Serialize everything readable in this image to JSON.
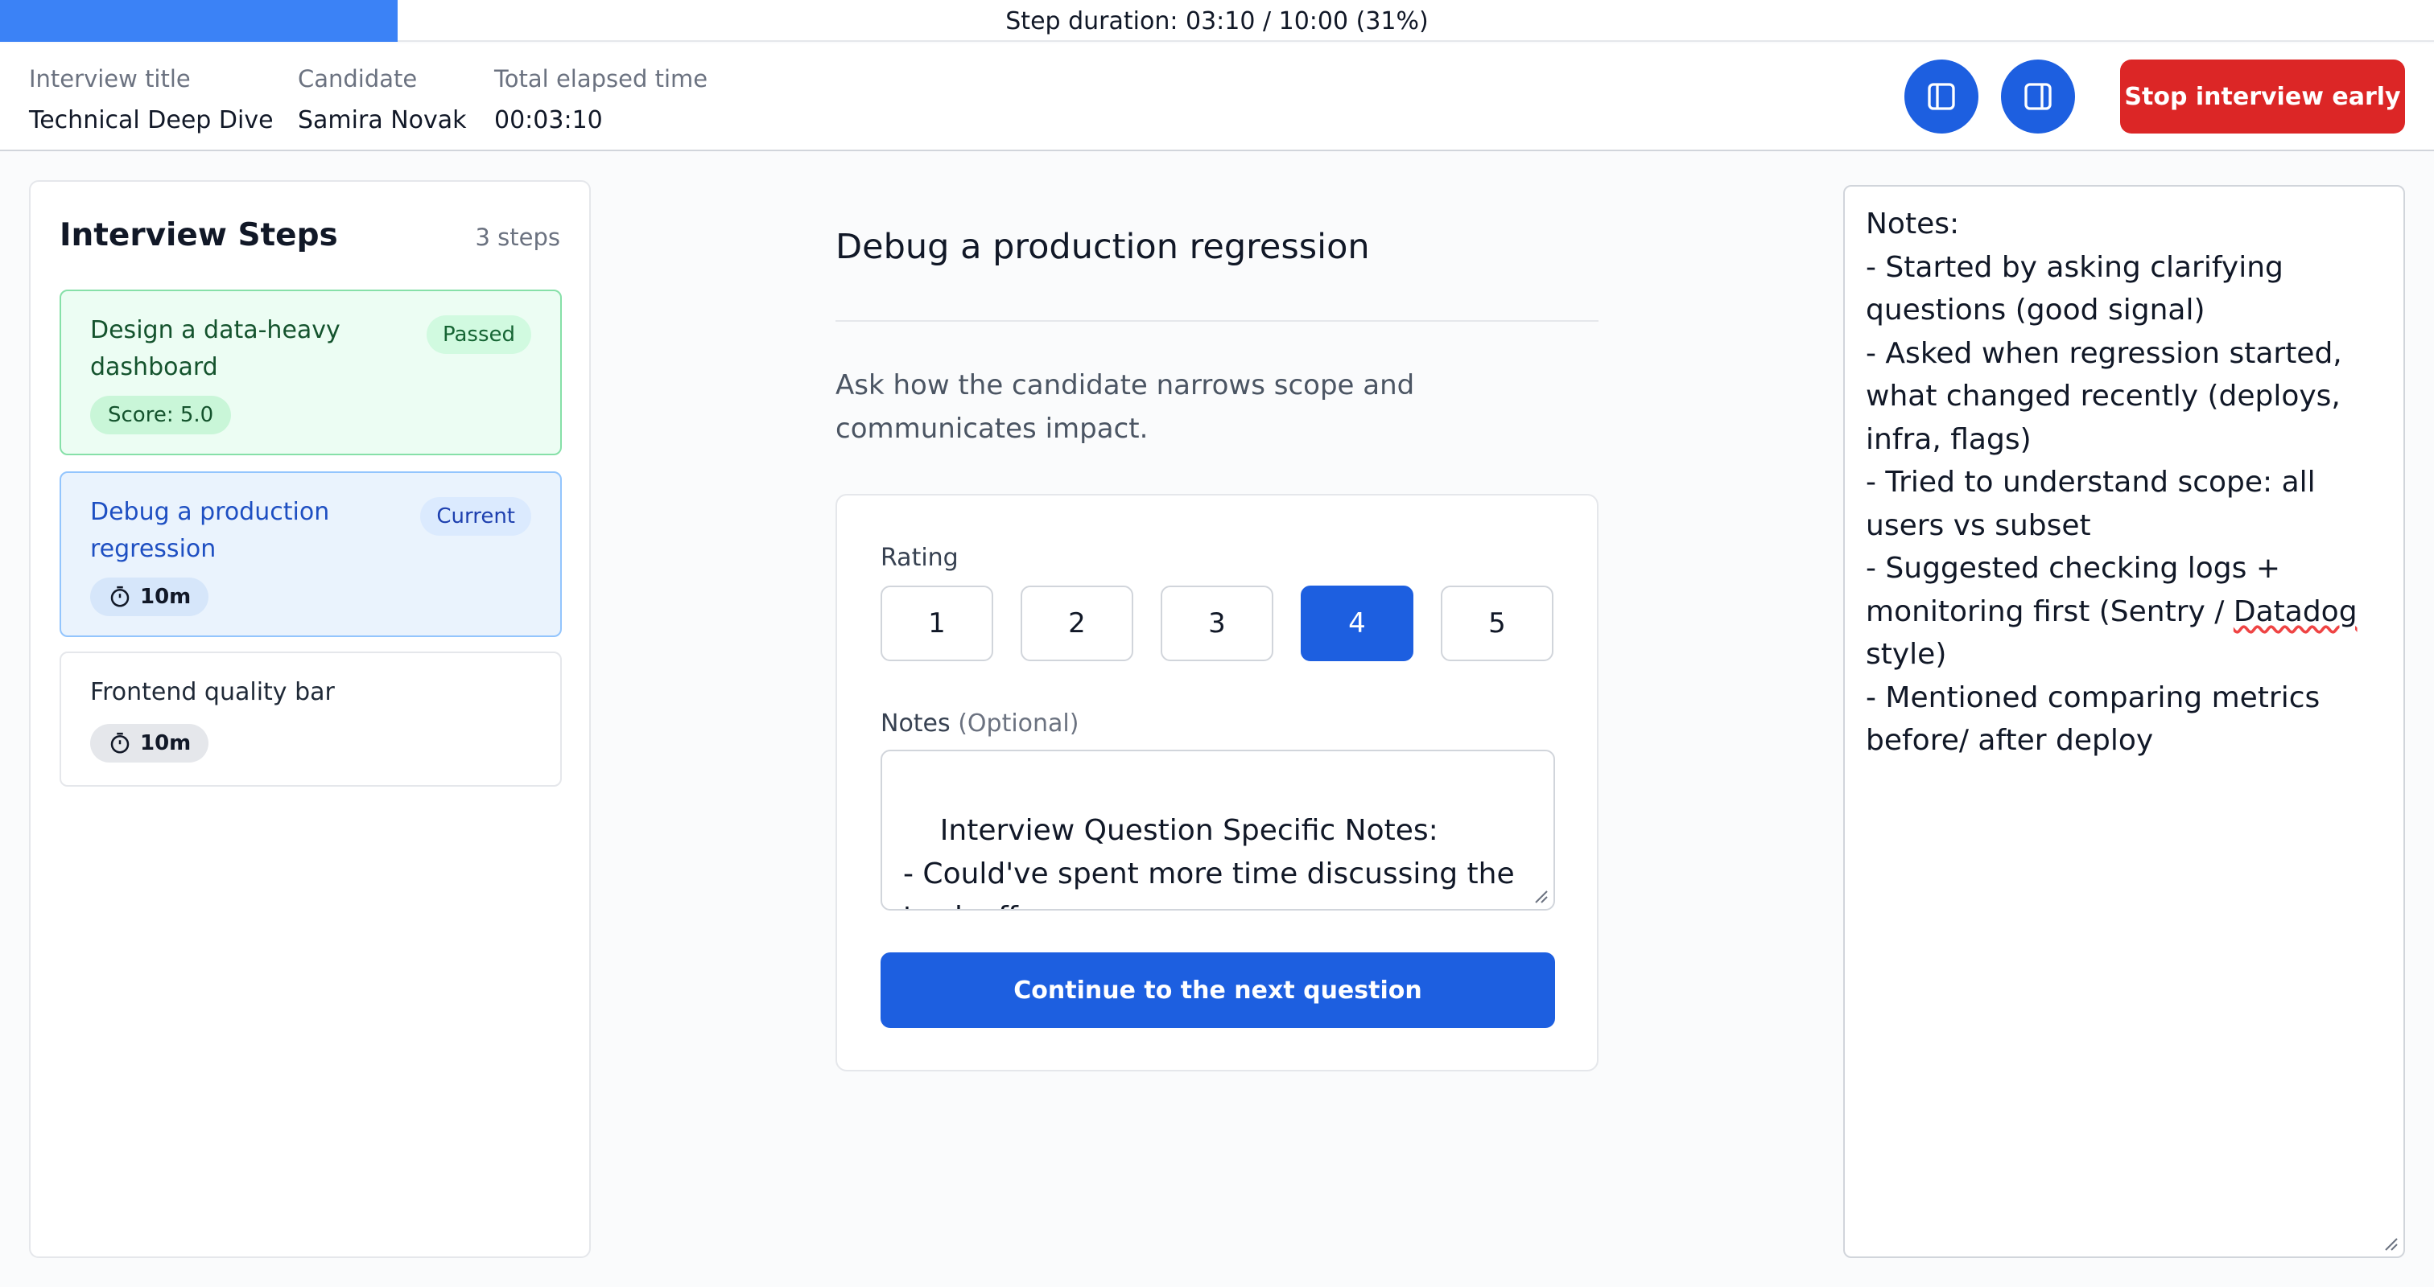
{
  "progress": {
    "label": "Step duration: 03:10 / 10:00 (31%)",
    "fraction": 0.31,
    "color": "#3b82f6"
  },
  "header": {
    "interview_title_label": "Interview title",
    "interview_title": "Technical Deep Dive",
    "candidate_label": "Candidate",
    "candidate": "Samira Novak",
    "elapsed_label": "Total elapsed time",
    "elapsed": "00:03:10",
    "left_panel_icon": "panel-left-icon",
    "right_panel_icon": "panel-right-icon",
    "stop_label": "Stop interview early"
  },
  "sidebar": {
    "title": "Interview Steps",
    "count": "3 steps",
    "steps": [
      {
        "title": "Design a data-heavy dashboard",
        "status": "Passed",
        "score": "Score: 5.0"
      },
      {
        "title": "Debug a production regression",
        "status": "Current",
        "duration": "10m"
      },
      {
        "title": "Frontend quality bar",
        "duration": "10m"
      }
    ]
  },
  "question": {
    "title": "Debug a production regression",
    "description": "Ask how the candidate narrows scope and communicates impact.",
    "rating_label": "Rating",
    "ratings": [
      "1",
      "2",
      "3",
      "4",
      "5"
    ],
    "selected_rating": "4",
    "notes_label": "Notes",
    "notes_optional": "(Optional)",
    "notes_value": "Interview Question Specific Notes:\n- Could've spent more time discussing the tradeoffs.",
    "continue_label": "Continue to the next question"
  },
  "side_notes": {
    "lines": [
      "Notes:",
      "- Started by asking clarifying questions (good signal)",
      "- Asked when regression started, what changed recently (deploys, infra, flags)",
      "- Tried to understand scope: all users vs subset",
      "- Suggested checking logs + monitoring first (Sentry / ",
      "Datadog",
      " style)",
      "- Mentioned comparing metrics before/ after deploy"
    ]
  },
  "colors": {
    "primary": "#1d5fe0",
    "danger": "#dc2626",
    "passed_bg": "#ecfdf3",
    "current_bg": "#eaf3fd"
  }
}
